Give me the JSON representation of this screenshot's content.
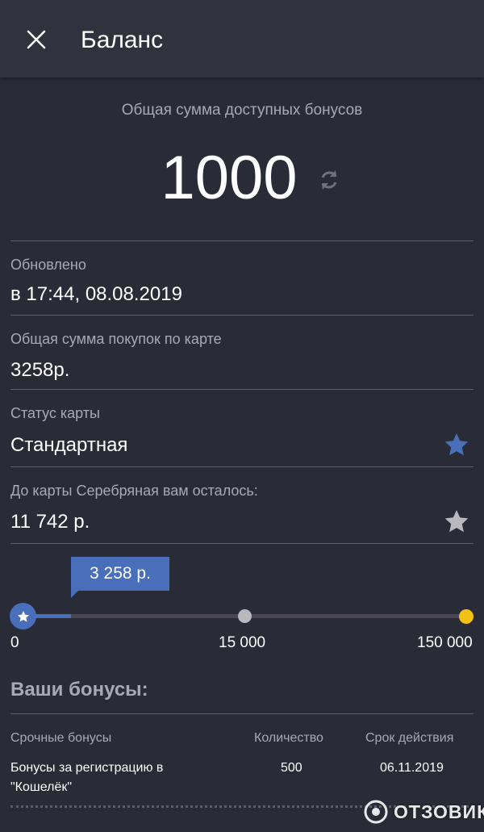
{
  "header": {
    "close_icon": "close-icon",
    "title": "Баланс"
  },
  "total": {
    "label": "Общая сумма доступных бонусов",
    "value": "1000",
    "refresh_icon": "refresh-icon"
  },
  "rows": [
    {
      "label": "Обновлено",
      "value": "в 17:44, 08.08.2019"
    },
    {
      "label": "Общая сумма покупок по карте",
      "value": "3258р."
    },
    {
      "label": "Статус карты",
      "value": "Стандартная",
      "icon": "star-icon",
      "icon_color": "#4a6fba"
    },
    {
      "label": "До карты Серебряная вам осталось:",
      "value": "11 742 р.",
      "icon": "star-icon",
      "icon_color": "#b8b8bd"
    }
  ],
  "progress": {
    "current_label": "3 258 р.",
    "current_value": 3258,
    "ticks": [
      "0",
      "15 000",
      "150 000"
    ],
    "accent": "#4a6fba",
    "silver": "#b8b8bd",
    "gold": "#f3c018"
  },
  "bonuses": {
    "title": "Ваши бонусы:",
    "columns": [
      "Срочные бонусы",
      "Количество",
      "Срок действия"
    ],
    "rows": [
      {
        "name": "Бонусы за регистрацию в \"Кошелёк\"",
        "qty": "500",
        "expires": "06.11.2019"
      }
    ]
  },
  "watermark": {
    "text": "ОТЗОВИК",
    "icon": "otzovik-logo-icon"
  }
}
